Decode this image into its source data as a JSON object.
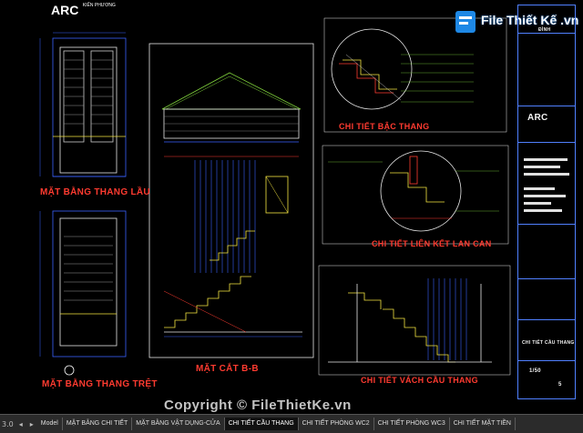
{
  "brand": {
    "arc_logo": "ARC",
    "arc_logo_sub": "KIẾN PHƯƠNG",
    "site_logo": "File Thiết Kế .vn",
    "watermark": "Copyright © FileThietKe.vn"
  },
  "drawings": {
    "plan_upper": "MẶT BẰNG THANG LẦU",
    "plan_ground": "MẶT BẰNG THANG TRỆT",
    "section_bb": "MẶT CẮT B-B",
    "detail_step": "CHI TIẾT BẬC THANG",
    "detail_railing": "CHI TIẾT LIÊN KẾT LAN CAN",
    "detail_stair_wall": "CHI TIẾT VÁCH CẦU THANG"
  },
  "titleblock": {
    "sheet_name": "CHI TIẾT CẦU THANG",
    "scale": "1/50",
    "owner_label": "ĐÌNH",
    "page": "5"
  },
  "tabs": [
    {
      "label": "Model",
      "active": false
    },
    {
      "label": "MẶT BẰNG CHI TIẾT",
      "active": false
    },
    {
      "label": "MẶT BẰNG VẬT DỤNG-CỬA",
      "active": false
    },
    {
      "label": "CHI TIẾT CẦU THANG",
      "active": true
    },
    {
      "label": "CHI TIẾT PHÒNG WC2",
      "active": false
    },
    {
      "label": "CHI TIẾT PHÒNG WC3",
      "active": false
    },
    {
      "label": "CHI TIẾT MẶT TIỀN",
      "active": false
    }
  ],
  "status": {
    "zoom": "3.0"
  },
  "colors": {
    "background": "#000000",
    "label_red": "#ff3b30",
    "line_blue": "#3a62ff",
    "line_cyan": "#33d6ff",
    "stair_yellow": "#f4e542",
    "roof_green": "#7fd13b"
  }
}
